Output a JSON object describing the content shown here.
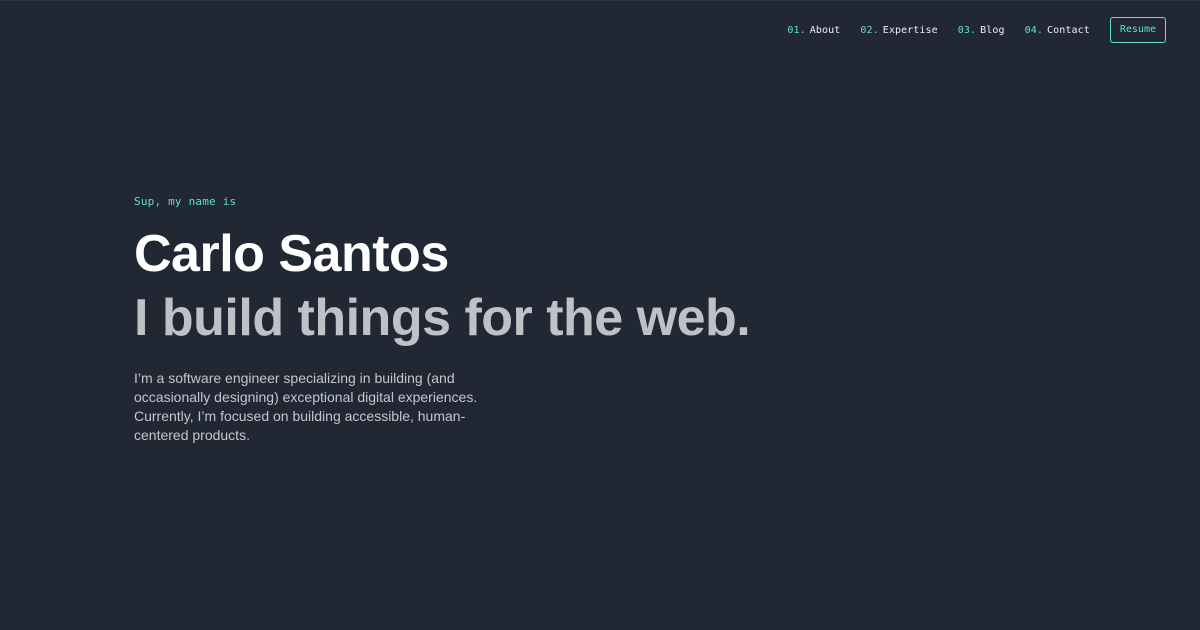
{
  "nav": {
    "items": [
      {
        "number": "01.",
        "label": "About"
      },
      {
        "number": "02.",
        "label": "Expertise"
      },
      {
        "number": "03.",
        "label": "Blog"
      },
      {
        "number": "04.",
        "label": "Contact"
      }
    ],
    "resume_label": "Resume"
  },
  "hero": {
    "greeting": "Sup, my name is",
    "name": "Carlo Santos",
    "tagline": "I build things for the web.",
    "description": "I’m a software engineer specializing in building (and occasionally designing) exceptional digital experiences. Currently, I’m focused on building accessible, human-centered products."
  },
  "colors": {
    "background": "#212834",
    "accent": "#5fe0cd",
    "heading": "#ffffff",
    "tagline": "#bfc1c6",
    "body_text": "#c3c6cc"
  }
}
